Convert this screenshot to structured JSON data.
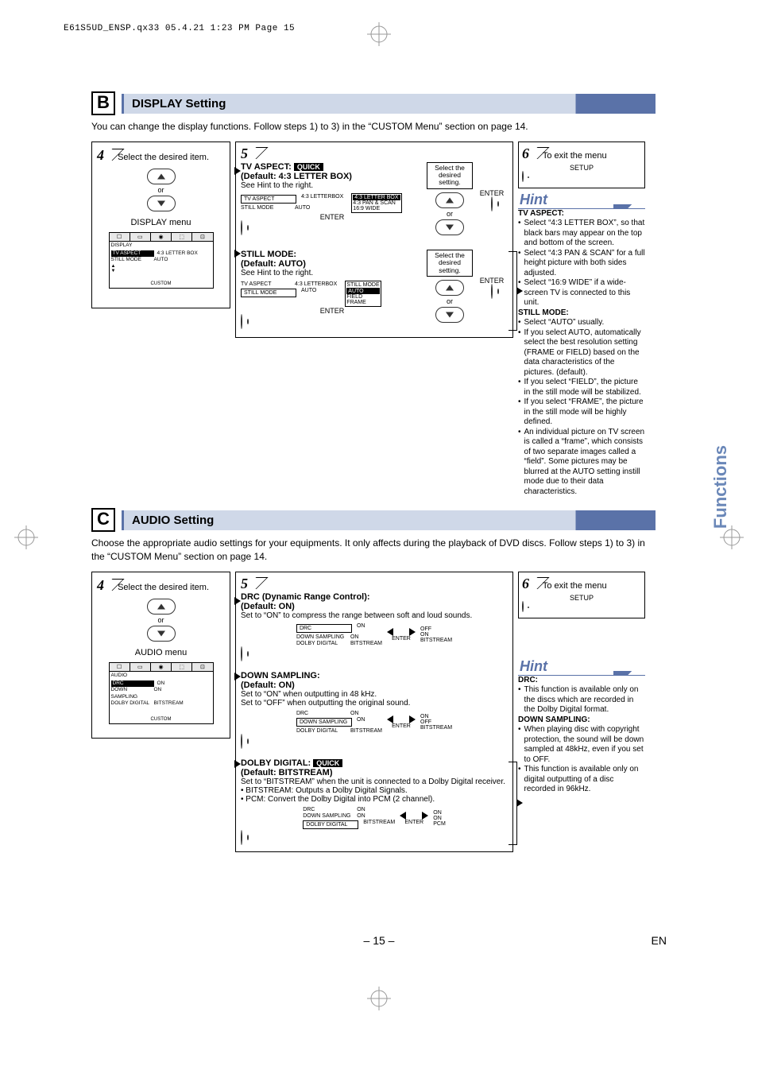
{
  "header_line": "E61S5UD_ENSP.qx33  05.4.21  1:23 PM  Page 15",
  "side_tab": "Functions",
  "page_number": "– 15 –",
  "lang": "EN",
  "sectionB": {
    "letter": "B",
    "title": "DISPLAY Setting",
    "intro": "You can change the display functions. Follow steps 1) to 3) in the “CUSTOM Menu” section on page 14.",
    "step4": {
      "num": "4",
      "text": "Select the desired item.",
      "or": "or",
      "menu_label": "DISPLAY menu"
    },
    "osd_display": {
      "title": "DISPLAY",
      "rows": [
        {
          "k": "TV ASPECT",
          "v": "4:3 LETTER BOX",
          "hl": true
        },
        {
          "k": "STILL MODE",
          "v": "AUTO"
        }
      ],
      "custom": "CUSTOM"
    },
    "step5": {
      "num": "5",
      "tv_aspect": {
        "heading": "TV ASPECT:",
        "quick": "QUICK",
        "default": "(Default: 4:3 LETTER BOX)",
        "note": "See Hint to the right.",
        "left_rows": [
          {
            "k": "TV ASPECT",
            "v": "4:3 LETTERBOX",
            "hlk": true
          },
          {
            "k": "STILL MODE",
            "v": "AUTO"
          }
        ],
        "right_opts": [
          "4:3 LETTER BOX",
          "4:3 PAN & SCAN",
          "16:9 WIDE"
        ],
        "right_opts_hl": "4:3 LETTER BOX",
        "selbox": "Select the desired setting.",
        "enter": "ENTER",
        "or": "or"
      },
      "still_mode": {
        "heading": "STILL MODE:",
        "default": "(Default: AUTO)",
        "note": "See Hint to the right.",
        "left_rows": [
          {
            "k": "TV ASPECT",
            "v": "4:3 LETTERBOX"
          },
          {
            "k": "STILL MODE",
            "v": "AUTO",
            "hlk": true
          }
        ],
        "right_opts": [
          "AUTO",
          "FIELD",
          "FRAME"
        ],
        "right_opts_hl": "AUTO",
        "right_header": "STILL MODE",
        "selbox": "Select the desired setting.",
        "enter": "ENTER",
        "or": "or"
      }
    },
    "step6": {
      "num": "6",
      "text": "To exit the menu",
      "label": "SETUP"
    },
    "hint": {
      "title": "Hint",
      "tv_aspect_h": "TV ASPECT:",
      "b1": "Select “4:3 LETTER BOX”, so that black bars may appear on the top and bottom of the screen.",
      "b2": "Select “4:3 PAN & SCAN” for a full height picture with both sides adjusted.",
      "b3": "Select “16:9 WIDE” if a wide-screen TV is connected to this unit.",
      "still_h": "STILL MODE:",
      "b4": "Select “AUTO” usually.",
      "b5": "If you select AUTO, automatically select the best resolution setting (FRAME or FIELD) based on the data characteristics of the pictures. (default).",
      "b6": "If you select “FIELD”, the picture in the still mode will be stabilized.",
      "b7": "If you select “FRAME”, the picture in the still mode will be highly defined.",
      "b8": "An individual picture on TV screen is called a “frame”, which consists of two separate images called a “field”. Some pictures may be blurred at the AUTO setting instill mode due to their data characteristics."
    }
  },
  "sectionC": {
    "letter": "C",
    "title": "AUDIO Setting",
    "intro": "Choose the appropriate audio settings for your equipments. It only affects during the playback of DVD discs. Follow steps 1) to 3) in the “CUSTOM Menu” section on page 14.",
    "step4": {
      "num": "4",
      "text": "Select the desired item.",
      "or": "or",
      "menu_label": "AUDIO menu"
    },
    "osd_audio": {
      "title": "AUDIO",
      "rows": [
        {
          "k": "DRC",
          "v": "ON",
          "hl": true
        },
        {
          "k": "DOWN SAMPLING",
          "v": "ON"
        },
        {
          "k": "DOLBY DIGITAL",
          "v": "BITSTREAM"
        }
      ],
      "custom": "CUSTOM"
    },
    "step5": {
      "num": "5",
      "drc": {
        "heading": "DRC (Dynamic Range Control):",
        "default": "(Default: ON)",
        "note": "Set to “ON” to compress the range between soft and loud sounds.",
        "left_rows": [
          {
            "k": "DRC",
            "v": "ON",
            "hlk": true
          },
          {
            "k": "DOWN SAMPLING",
            "v": "ON"
          },
          {
            "k": "DOLBY DIGITAL",
            "v": "BITSTREAM"
          }
        ],
        "right": [
          "OFF",
          "ON",
          "BITSTREAM"
        ],
        "enter": "ENTER"
      },
      "down": {
        "heading": "DOWN SAMPLING:",
        "default": "(Default: ON)",
        "note1": "Set to “ON” when outputting in 48 kHz.",
        "note2": "Set to “OFF” when outputting the original sound.",
        "left_rows": [
          {
            "k": "DRC",
            "v": "ON"
          },
          {
            "k": "DOWN SAMPLING",
            "v": "ON",
            "hlk": true
          },
          {
            "k": "DOLBY DIGITAL",
            "v": "BITSTREAM"
          }
        ],
        "right": [
          "ON",
          "OFF",
          "BITSTREAM"
        ],
        "enter": "ENTER"
      },
      "dolby": {
        "heading": "DOLBY DIGITAL:",
        "quick": "QUICK",
        "default": "(Default: BITSTREAM)",
        "note": "Set to “BITSTREAM” when the unit is connected to a Dolby Digital receiver.",
        "b1": "• BITSTREAM: Outputs a Dolby Digital Signals.",
        "b2": "• PCM: Convert the Dolby Digital into PCM (2 channel).",
        "left_rows": [
          {
            "k": "DRC",
            "v": "ON"
          },
          {
            "k": "DOWN SAMPLING",
            "v": "ON"
          },
          {
            "k": "DOLBY DIGITAL",
            "v": "BITSTREAM",
            "hlk": true
          }
        ],
        "right": [
          "ON",
          "ON",
          "PCM"
        ],
        "enter": "ENTER"
      }
    },
    "step6": {
      "num": "6",
      "text": "To exit the menu",
      "label": "SETUP"
    },
    "hint": {
      "title": "Hint",
      "drc_h": "DRC:",
      "b1": "This function is available only on the discs which are recorded in the Dolby Digital format.",
      "down_h": "DOWN SAMPLING:",
      "b2": "When playing disc with copyright protection, the sound will be down sampled at 48kHz, even if you set to OFF.",
      "b3": "This function is available only on digital outputting of a disc recorded in 96kHz."
    }
  }
}
